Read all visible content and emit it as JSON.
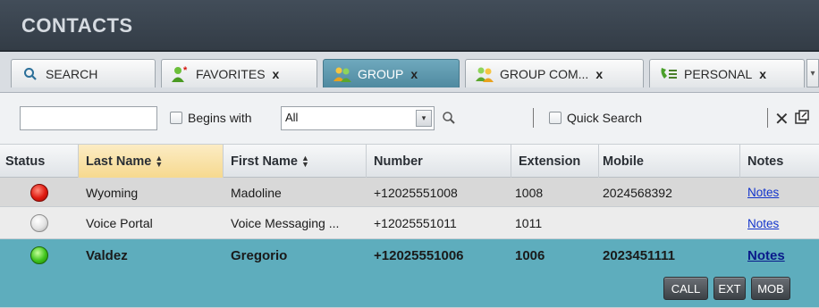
{
  "header": {
    "title": "CONTACTS"
  },
  "tabs": [
    {
      "label": "SEARCH",
      "icon": "search-icon",
      "closable": false,
      "active": false
    },
    {
      "label": "FAVORITES",
      "icon": "favorites-icon",
      "closable": true,
      "active": false
    },
    {
      "label": "GROUP",
      "icon": "group-icon",
      "closable": true,
      "active": true
    },
    {
      "label": "GROUP COM...",
      "icon": "group-common-icon",
      "closable": true,
      "active": false
    },
    {
      "label": "PERSONAL",
      "icon": "personal-icon",
      "closable": true,
      "active": false
    }
  ],
  "tab_close_label": "x",
  "filter": {
    "search_value": "",
    "begins_with_label": "Begins with",
    "begins_with_checked": false,
    "field_select": "All",
    "quick_search_label": "Quick Search",
    "quick_search_checked": false
  },
  "table": {
    "columns": [
      "Status",
      "Last Name",
      "First Name",
      "Number",
      "Extension",
      "Mobile",
      "Notes"
    ],
    "sorted_column": "Last Name",
    "rows": [
      {
        "status": "busy",
        "status_color": "#e01a10",
        "last_name": "Wyoming",
        "first_name": "Madoline",
        "number": "+12025551008",
        "extension": "1008",
        "mobile": "2024568392",
        "notes": "Notes"
      },
      {
        "status": "unknown",
        "status_color": "#e3e3e3",
        "last_name": "Voice Portal",
        "first_name": "Voice Messaging ...",
        "number": "+12025551011",
        "extension": "1011",
        "mobile": "",
        "notes": "Notes"
      },
      {
        "status": "available",
        "status_color": "#3fc41c",
        "last_name": "Valdez",
        "first_name": "Gregorio",
        "number": "+12025551006",
        "extension": "1006",
        "mobile": "2023451111",
        "notes": "Notes",
        "selected": true
      }
    ]
  },
  "row_actions": {
    "call": "CALL",
    "ext": "EXT",
    "mob": "MOB"
  },
  "colors": {
    "title_bar": "#3a444e",
    "active_tab": "#5f9cb2",
    "selected_row": "#5eadbd",
    "sorted_header": "#f6d98f"
  }
}
